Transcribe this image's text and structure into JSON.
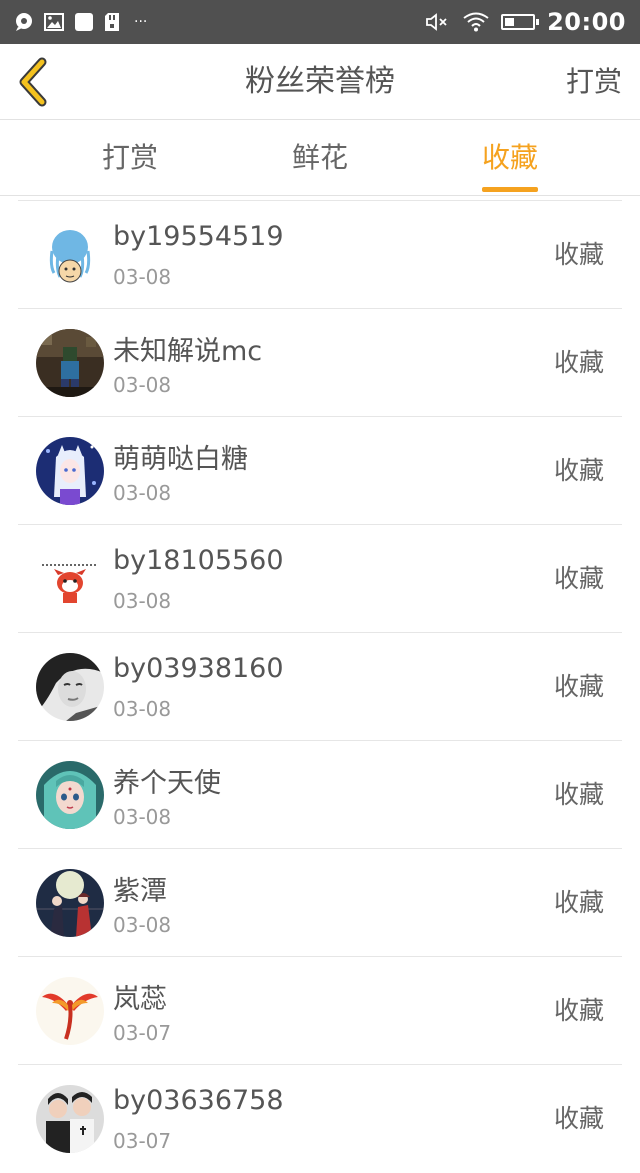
{
  "status_bar": {
    "time": "20:00",
    "left_icons": [
      "chat-bubble-icon",
      "image-icon",
      "white-square-icon",
      "sd-card-icon",
      "more-dots-icon"
    ],
    "right_icons": [
      "mute-icon",
      "wifi-icon",
      "battery-icon"
    ],
    "battery_level": 0.35,
    "more_glyph": "···"
  },
  "header": {
    "title": "粉丝荣誉榜",
    "action_label": "打赏",
    "accent_color": "#f5a21f"
  },
  "tabs": [
    {
      "label": "打赏",
      "active": false
    },
    {
      "label": "鲜花",
      "active": false
    },
    {
      "label": "收藏",
      "active": true
    }
  ],
  "list": {
    "items": [
      {
        "name": "by19554519",
        "date": "03-08",
        "type": "收藏",
        "avatar": "jellyfish-cartoon"
      },
      {
        "name": "未知解说mc",
        "date": "03-08",
        "type": "收藏",
        "avatar": "minecraft-character"
      },
      {
        "name": "萌萌哒白糖",
        "date": "03-08",
        "type": "收藏",
        "avatar": "anime-girl-blue"
      },
      {
        "name": "by18105560",
        "date": "03-08",
        "type": "收藏",
        "avatar": "red-fox-cartoon"
      },
      {
        "name": "by03938160",
        "date": "03-08",
        "type": "收藏",
        "avatar": "grayscale-portrait"
      },
      {
        "name": "养个天使",
        "date": "03-08",
        "type": "收藏",
        "avatar": "anime-girl-teal"
      },
      {
        "name": "紫潭",
        "date": "03-08",
        "type": "收藏",
        "avatar": "anime-couple-moon"
      },
      {
        "name": "岚蕊",
        "date": "03-07",
        "type": "收藏",
        "avatar": "phoenix-bird"
      },
      {
        "name": "by03636758",
        "date": "03-07",
        "type": "收藏",
        "avatar": "couple-photo"
      }
    ]
  }
}
